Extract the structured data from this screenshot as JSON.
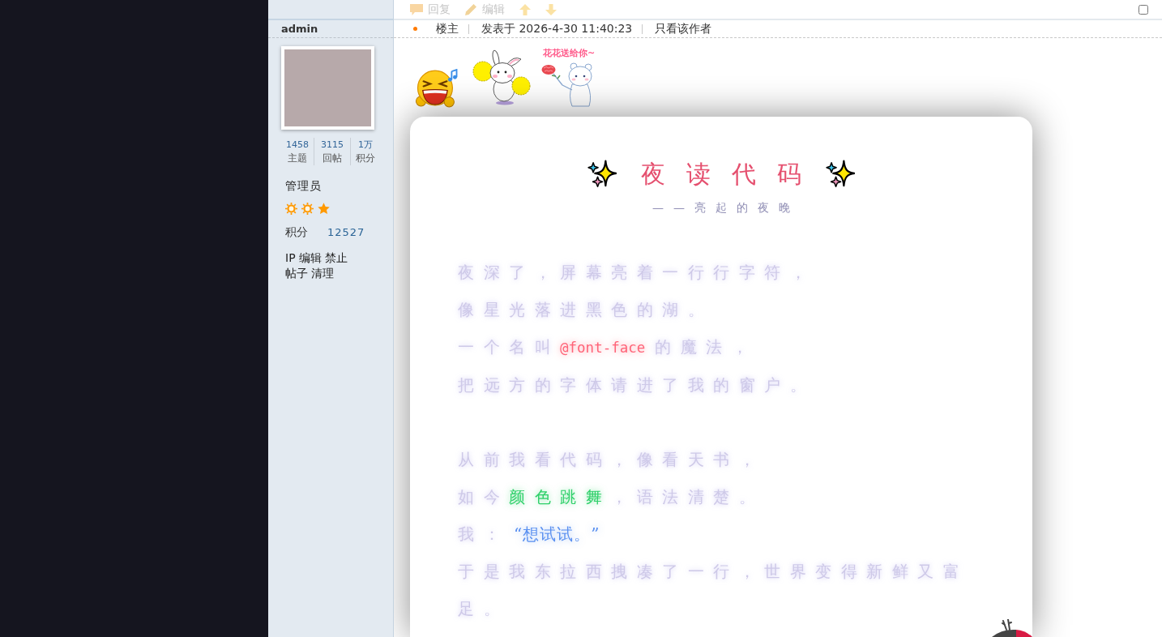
{
  "toolbar": {
    "actions": [
      {
        "kind": "reply",
        "label": "回复"
      },
      {
        "kind": "edit",
        "label": "编辑"
      },
      {
        "kind": "up"
      },
      {
        "kind": "down"
      }
    ],
    "select_checkbox": {
      "checked": false
    }
  },
  "post_meta": {
    "floor": "楼主",
    "posted": "发表于 2026-4-30 11:40:23",
    "author_only_link": "只看该作者"
  },
  "author": {
    "name": "admin",
    "stats": [
      {
        "value": "1458",
        "label": "主题"
      },
      {
        "value": "3115",
        "label": "回帖"
      },
      {
        "value": "1万",
        "label": "积分"
      }
    ],
    "group": "管理员",
    "rank_icons": [
      {
        "kind": "sun"
      },
      {
        "kind": "sun"
      },
      {
        "kind": "star"
      }
    ],
    "points": {
      "label": "积分",
      "value": "12527"
    },
    "admin_links": [
      "IP",
      "编辑",
      "禁止",
      "帖子",
      "清理"
    ]
  },
  "stickers": [
    {
      "kind": "laughing-face"
    },
    {
      "kind": "bunny"
    },
    {
      "kind": "bear",
      "caption": "花花送给你~"
    }
  ],
  "poem": {
    "title": "夜读代码",
    "subtitle": "——亮起的夜晚",
    "stanzas": [
      {
        "lines": [
          {
            "segments": [
              {
                "kind": "plain",
                "text": "夜深了，屏幕亮着一行行字符，"
              }
            ]
          },
          {
            "segments": [
              {
                "kind": "plain",
                "text": "像星光落进黑色的湖。"
              }
            ]
          },
          {
            "segments": [
              {
                "kind": "plain",
                "text": "一个名叫"
              },
              {
                "kind": "code",
                "text": "@font-face"
              },
              {
                "kind": "plain",
                "text": "的魔法，"
              }
            ]
          },
          {
            "segments": [
              {
                "kind": "plain",
                "text": "把远方的字体请进了我的窗户。"
              }
            ]
          }
        ]
      },
      {
        "lines": [
          {
            "segments": [
              {
                "kind": "plain",
                "text": "从前我看代码，像看天书，"
              }
            ]
          },
          {
            "segments": [
              {
                "kind": "plain",
                "text": "如今"
              },
              {
                "kind": "highlight",
                "text": "颜色跳舞"
              },
              {
                "kind": "plain",
                "text": "，语法清楚。"
              }
            ]
          },
          {
            "segments": [
              {
                "kind": "plain",
                "text": "我："
              },
              {
                "kind": "quote",
                "text": "“想试试。”"
              }
            ]
          },
          {
            "segments": [
              {
                "kind": "plain",
                "text": "于是我东拉西拽凑了一行，世界变得新鲜又富足。"
              }
            ]
          }
        ]
      }
    ]
  }
}
